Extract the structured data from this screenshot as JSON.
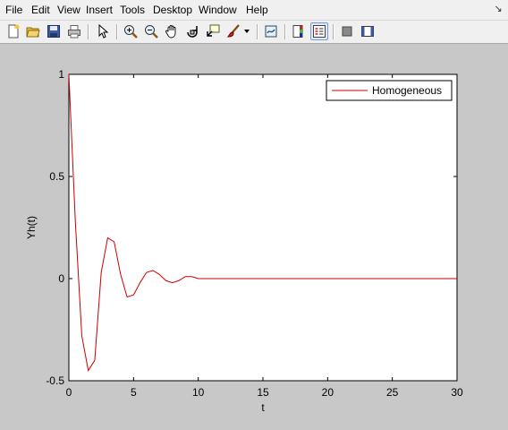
{
  "menu": {
    "items": [
      "File",
      "Edit",
      "View",
      "Insert",
      "Tools",
      "Desktop",
      "Window",
      "Help"
    ],
    "corner_icon": "dock-arrow-icon"
  },
  "toolbar": {
    "buttons": [
      "new-figure-icon",
      "open-file-icon",
      "save-figure-icon",
      "print-figure-icon",
      "edit-plot-arrow-icon",
      "zoom-in-icon",
      "zoom-out-icon",
      "pan-hand-icon",
      "rotate-3d-icon",
      "data-cursor-icon",
      "brush-data-icon",
      "brush-dropdown-icon",
      "link-plot-icon",
      "insert-colorbar-icon",
      "insert-legend-icon",
      "hide-plot-tools-icon",
      "show-plot-tools-icon"
    ]
  },
  "chart_data": {
    "type": "line",
    "xlabel": "t",
    "ylabel": "Yh(t)",
    "xlim": [
      0,
      30
    ],
    "ylim": [
      -0.5,
      1
    ],
    "xticks": [
      0,
      5,
      10,
      15,
      20,
      25,
      30
    ],
    "yticks": [
      -0.5,
      0,
      0.5,
      1
    ],
    "xtick_labels": [
      "0",
      "5",
      "10",
      "15",
      "20",
      "25",
      "30"
    ],
    "ytick_labels": [
      "-0.5",
      "0",
      "0.5",
      "1"
    ],
    "grid": false,
    "legend": "top-right",
    "series": [
      {
        "name": "Homogeneous",
        "color": "#cc0000",
        "x": [
          0,
          0.5,
          1.0,
          1.5,
          2.0,
          2.5,
          3.0,
          3.5,
          4.0,
          4.5,
          5.0,
          5.5,
          6.0,
          6.5,
          7.0,
          7.5,
          8.0,
          8.5,
          9.0,
          9.5,
          10.0,
          11,
          12,
          13,
          14,
          15,
          16,
          17,
          18,
          19,
          20,
          21,
          22,
          23,
          24,
          25,
          26,
          27,
          28,
          29,
          30
        ],
        "y": [
          1.0,
          0.28,
          -0.28,
          -0.45,
          -0.4,
          0.03,
          0.2,
          0.18,
          0.02,
          -0.09,
          -0.08,
          -0.02,
          0.03,
          0.04,
          0.02,
          -0.01,
          -0.02,
          -0.01,
          0.01,
          0.01,
          0.0,
          0.0,
          0.0,
          0.0,
          0.0,
          0.0,
          0.0,
          0.0,
          0.0,
          0.0,
          0.0,
          0.0,
          0.0,
          0.0,
          0.0,
          0.0,
          0.0,
          0.0,
          0.0,
          0.0,
          0.0
        ]
      }
    ]
  }
}
